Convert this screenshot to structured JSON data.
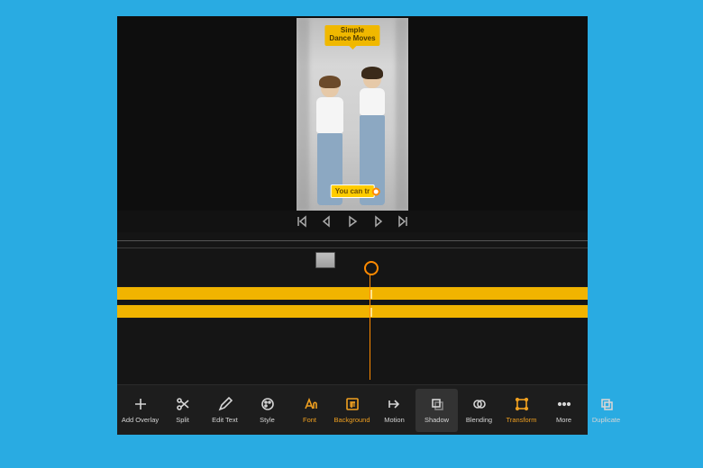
{
  "preview": {
    "caption_top_line1": "Simple",
    "caption_top_line2": "Dance Moves",
    "caption_bottom": "You can tr"
  },
  "playback": {
    "skip_start": "skip-start",
    "prev_frame": "prev-frame",
    "play": "play",
    "next_frame": "next-frame",
    "skip_end": "skip-end"
  },
  "toolbar": {
    "items": [
      {
        "name": "add-overlay",
        "label": "Add Overlay",
        "accent": false
      },
      {
        "name": "split",
        "label": "Split",
        "accent": false
      },
      {
        "name": "edit-text",
        "label": "Edit Text",
        "accent": false
      },
      {
        "name": "style",
        "label": "Style",
        "accent": false
      },
      {
        "name": "font",
        "label": "Font",
        "accent": true
      },
      {
        "name": "background",
        "label": "Background",
        "accent": true
      },
      {
        "name": "motion",
        "label": "Motion",
        "accent": false
      },
      {
        "name": "shadow",
        "label": "Shadow",
        "accent": false,
        "selected": true
      },
      {
        "name": "blending",
        "label": "Blending",
        "accent": false
      },
      {
        "name": "transform",
        "label": "Transform",
        "accent": true
      },
      {
        "name": "more",
        "label": "More",
        "accent": false
      },
      {
        "name": "duplicate",
        "label": "Duplicate",
        "accent": false
      }
    ]
  },
  "colors": {
    "accent": "#f0a020",
    "track": "#f1b400",
    "playhead": "#ff8a00"
  }
}
